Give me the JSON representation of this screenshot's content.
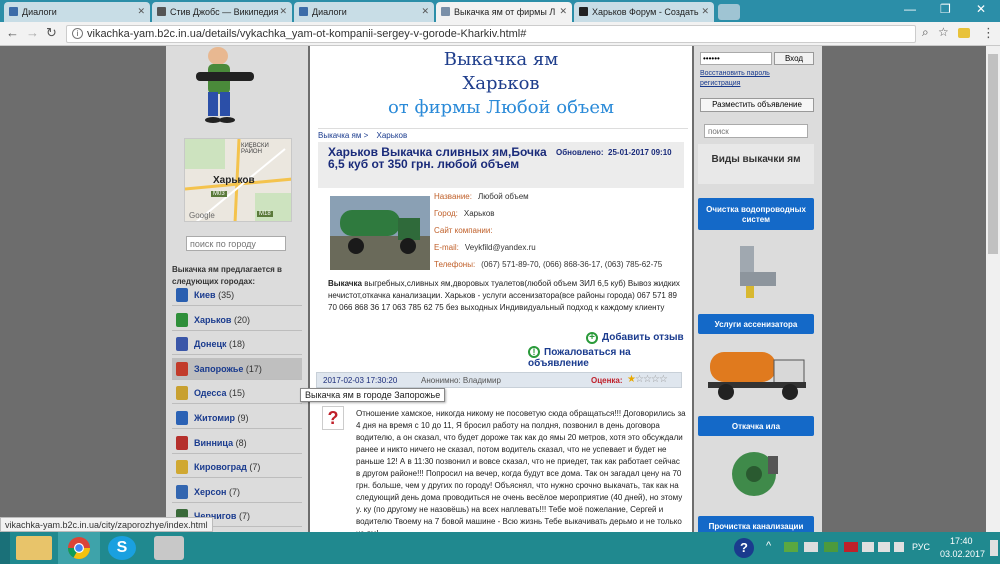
{
  "browser": {
    "tabs": [
      {
        "label": "Диалоги"
      },
      {
        "label": "Стив Джобс — Википедия"
      },
      {
        "label": "Диалоги"
      },
      {
        "label": "Выкачка ям от фирмы Л"
      },
      {
        "label": "Харьков Форум - Создать"
      }
    ],
    "url": "vikachka-yam.b2c.in.ua/details/vykachka_yam-ot-kompanii-sergey-v-gorode-Kharkiv.html#"
  },
  "left": {
    "map_labels": {
      "region": "КИЕВСКИ РАЙОН",
      "city": "Харьков",
      "road1": "М03",
      "road2": "М18",
      "brand": "Google"
    },
    "search_placeholder": "поиск по городу",
    "cities_heading": "Выкачка ям предлагается в следующих городах:",
    "cities": [
      {
        "name": "Киев",
        "count": "(35)",
        "color": "#2a5fb0"
      },
      {
        "name": "Харьков",
        "count": "(20)",
        "color": "#2f8f3a"
      },
      {
        "name": "Донецк",
        "count": "(18)",
        "color": "#3a56a8"
      },
      {
        "name": "Запорожье",
        "count": "(17)",
        "color": "#c23b2a"
      },
      {
        "name": "Одесса",
        "count": "(15)",
        "color": "#c8a030"
      },
      {
        "name": "Житомир",
        "count": "(9)",
        "color": "#2b62b5"
      },
      {
        "name": "Винница",
        "count": "(8)",
        "color": "#b5302c"
      },
      {
        "name": "Кировоград",
        "count": "(7)",
        "color": "#d0a832"
      },
      {
        "name": "Херсон",
        "count": "(7)",
        "color": "#3366b0"
      },
      {
        "name": "Чернигов",
        "count": "(7)",
        "color": "#3a6a3a"
      }
    ]
  },
  "header": {
    "line1": "Выкачка ям",
    "line2": "Харьков",
    "line3": "от фирмы Любой объем"
  },
  "breadcrumb": {
    "root": "Выкачка ям >",
    "city": "Харьков"
  },
  "listing": {
    "title": "Харьков Выкачка сливных ям,Бочка 6,5 куб от 350 грн. любой объем",
    "updated_label": "Обновлено:",
    "updated_value": "25-01-2017 09:10",
    "fields": [
      {
        "label": "Название:",
        "value": "Любой объем"
      },
      {
        "label": "Город:",
        "value": "Харьков"
      },
      {
        "label": "Сайт компании:",
        "value": ""
      },
      {
        "label": "E-mail:",
        "value": "Veykfild@yandex.ru"
      },
      {
        "label": "Телефоны:",
        "value": "(067) 571-89-70, (066) 868-36-17, (063) 785-62-75"
      }
    ],
    "description_bold": "Выкачка",
    "description": " выгребных,сливных ям,дворовых туалетов(любой объем ЗИЛ 6,5 куб) Вывоз жидких нечистот,откачка канализации. Харьков - услуги ассенизатора(все районы города) 067 571 89 70 066 868 36 17 063 785 62 75 без выходных Индивидуальный подход к каждому клиенту",
    "add_review": "Добавить отзыв",
    "complain": "Пожаловаться на объявление"
  },
  "review": {
    "date": "2017-02-03 17:30:20",
    "author": "Анонимно: Владимир",
    "rating_label": "Оценка:",
    "rating": 1,
    "text": "Отношение хамское, никогда никому не посоветую сюда обращаться!!! Договорились за 4 дня на время с 10 до 11, Я бросил работу на полдня, позвонил в день договора водителю, а он сказал, что будет дороже так как до ямы 20 метров, хотя это обсуждали ранее и никто ничего не сказал, потом водитель сказал, что не успевает и будет не раньше 12! А в 11:30 позвонил и вовсе сказал, что не приедет, так как работает сейчас в другом районе!!! Попросил на вечер, когда будут все дома. Так он загадал цену на 70 грн. больше, чем у других по городу! Объяснял, что нужно срочно выкачать, так как на следующий день дома проводиться не очень весёлое мероприятие (40 дней), но этому у. ку (по другому не назовёшь) на всех наплевать!!! Тебе моё пожелание, Сергей и водителю Твоему на 7 бовой машине - Всю жизнь Тебе выкачивать дерьмо и не только из ям!"
  },
  "tooltip": "Выкачка ям в городе Запорожье",
  "right": {
    "login_button": "Вход",
    "login_value": "••••••",
    "restore": "Восстановить пароль",
    "register": "регистрация",
    "post_ad": "Разместить объявление",
    "search_placeholder": "поиск",
    "types_heading": "Виды выкачки ям",
    "btn1": "Очистка водопроводных систем",
    "btn2": "Услуги ассенизатора",
    "btn3": "Откачка ила",
    "btn4": "Прочистка канализации"
  },
  "status_url": "vikachka-yam.b2c.in.ua/city/zaporozhye/index.html",
  "taskbar": {
    "lang": "РУС",
    "time": "17:40",
    "date": "03.02.2017"
  }
}
